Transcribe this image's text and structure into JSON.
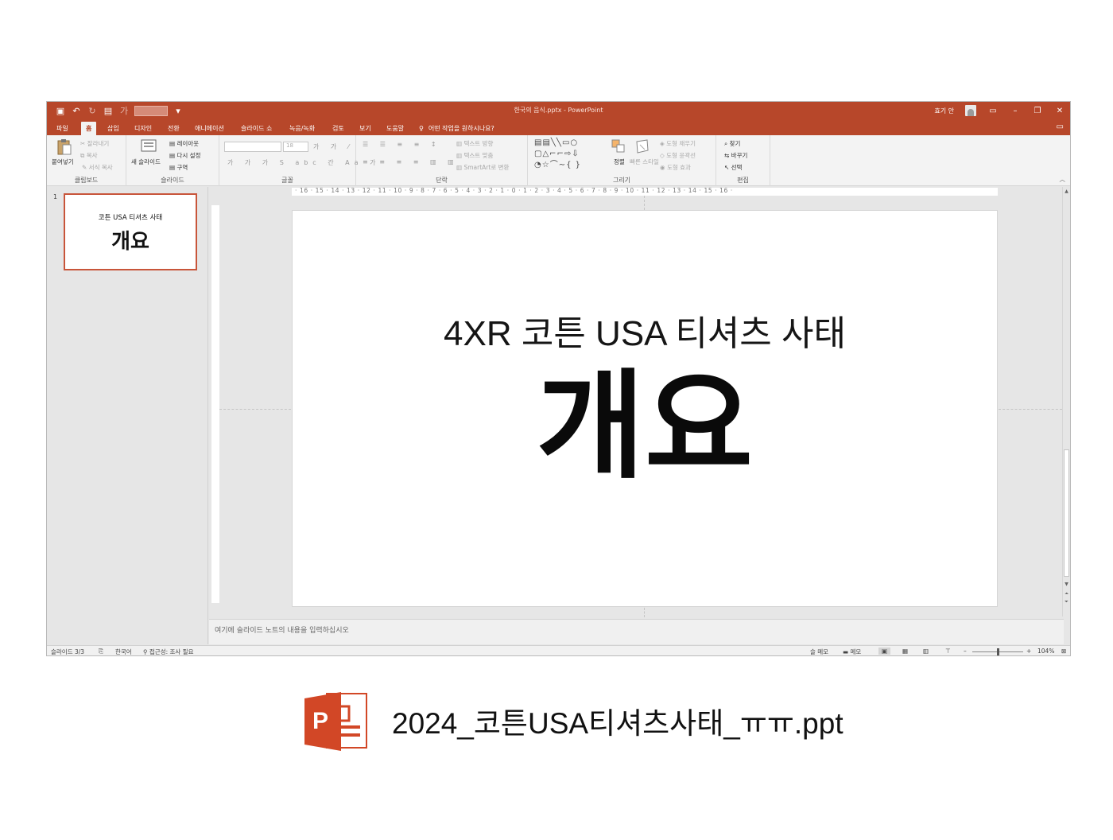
{
  "window": {
    "doc_title": "한국의 음식.pptx  -  PowerPoint",
    "user": "효기 안",
    "tabs": [
      "파일",
      "홈",
      "삽입",
      "디자인",
      "전환",
      "애니메이션",
      "슬라이드 쇼",
      "녹음/녹화",
      "검토",
      "보기",
      "도움말"
    ],
    "tell_me": "어떤 작업을 원하시나요?"
  },
  "ribbon": {
    "clipboard": {
      "label": "클립보드",
      "paste": "붙여넣기",
      "cut": "잘라내기",
      "copy": "복사",
      "format_painter": "서식 복사"
    },
    "slides": {
      "label": "슬라이드",
      "new_slide": "새 슬라이드",
      "layout": "레이아웃",
      "reset": "다시 설정",
      "section": "구역"
    },
    "font": {
      "label": "글꼴",
      "size": "18"
    },
    "paragraph": {
      "label": "단락",
      "text_direction": "텍스트 방향",
      "align_text": "텍스트 맞춤",
      "smartart": "SmartArt로 변환"
    },
    "drawing": {
      "label": "그리기",
      "arrange": "정렬",
      "quick_styles": "빠른 스타일",
      "fill": "도형 채우기",
      "outline": "도형 윤곽선",
      "effects": "도형 효과"
    },
    "editing": {
      "label": "편집",
      "find": "찾기",
      "replace": "바꾸기",
      "select": "선택"
    }
  },
  "thumbnail": {
    "number": "1",
    "subtitle": "코튼 USA 티셔츠 사태",
    "title": "개요"
  },
  "ruler": {
    "horizontal": "· 16 · 15 · 14 · 13 · 12 · 11 · 10 · 9 · 8 · 7 · 6 · 5 · 4 · 3 · 2 · 1 · 0 · 1 · 2 · 3 · 4 · 5 · 6 · 7 · 8 · 9 · 10 · 11 · 12 · 13 · 14 · 15 · 16 ·"
  },
  "slide": {
    "subtitle": "4XR 코튼 USA 티셔츠 사태",
    "title": "개요"
  },
  "notes": {
    "placeholder": "여기에 슬라이드 노트의 내용을 입력하십시오"
  },
  "status": {
    "slide": "슬라이드 3/3",
    "language": "한국어",
    "accessibility": "접근성: 조사 필요",
    "notes": "슬 메모",
    "comments": "메모",
    "zoom": "104%"
  },
  "file": {
    "name": "2024_코튼USA티셔츠사태_ㅠㅠ.ppt",
    "icon_letter": "P"
  },
  "colors": {
    "accent": "#b7472a",
    "ppt_icon": "#d24726"
  }
}
